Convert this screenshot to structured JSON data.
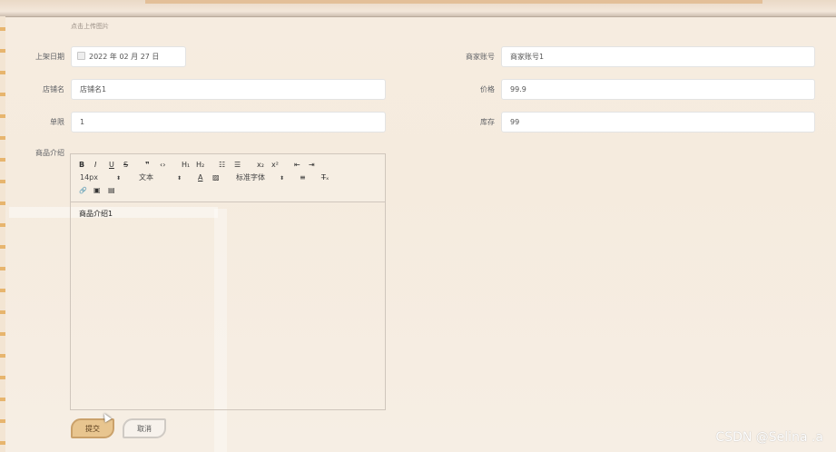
{
  "upload_hint": "点击上传图片",
  "form": {
    "shelf_date": {
      "label": "上架日期",
      "value": "2022 年 02 月 27 日"
    },
    "merchant_account": {
      "label": "商家账号",
      "value": "商家账号1"
    },
    "shop_name": {
      "label": "店铺名",
      "value": "店铺名1"
    },
    "price": {
      "label": "价格",
      "value": "99.9"
    },
    "purchase_limit": {
      "label": "单限",
      "value": "1"
    },
    "stock": {
      "label": "库存",
      "value": "99"
    },
    "description": {
      "label": "商品介绍",
      "content": "商品介绍1"
    }
  },
  "editor_toolbar": {
    "bold": "B",
    "italic": "I",
    "underline": "U",
    "strike": "S",
    "quote": "❞",
    "code": "‹›",
    "h1": "H₁",
    "h2": "H₂",
    "ordered_list": "☷",
    "bullet_list": "☰",
    "subscript": "x₂",
    "superscript": "x²",
    "indent_decrease": "⇤",
    "indent_increase": "⇥",
    "font_size": "14px",
    "text_style": "文本",
    "font_color": "A",
    "bg_color": "▨",
    "font_family": "标准字体",
    "align": "≡",
    "clear_format": "T̶ₓ",
    "link": "🔗",
    "image": "▣",
    "video": "▤"
  },
  "buttons": {
    "submit": "提交",
    "cancel": "取消"
  },
  "watermark": "CSDN @Selina .a",
  "colors": {
    "submit_bg": "#e8c58f",
    "cancel_bg": "#f7f2ec",
    "page_bg": "#f6ece0"
  }
}
